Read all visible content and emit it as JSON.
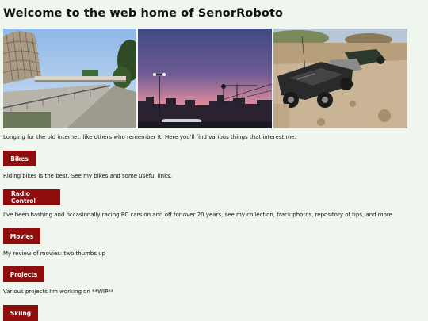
{
  "page": {
    "title": "Welcome to the web home of SenorRoboto",
    "intro": "Longing for the old internet, like others who remember it. Here you'll find various things that interest me."
  },
  "photos": [
    {
      "icon": "freeway-building-photo"
    },
    {
      "icon": "sunset-city-photo"
    },
    {
      "icon": "rc-cars-photo"
    }
  ],
  "sections": [
    {
      "label": "Bikes",
      "description": "Riding bikes is the best. See my bikes and some useful links."
    },
    {
      "label": "Radio Control",
      "description": "I've been bashing and occasionally racing RC cars on and off for over 20 years, see my collection, track photos, repository of tips, and more"
    },
    {
      "label": "Movies",
      "description": "My review of movies: two thumbs up"
    },
    {
      "label": "Projects",
      "description": "Various projects I'm working on **WIP**"
    },
    {
      "label": "Skiing",
      "description": ""
    }
  ],
  "colors": {
    "background": "#eef6ee",
    "button": "#8f0d0d",
    "button_text": "#ffffff"
  }
}
